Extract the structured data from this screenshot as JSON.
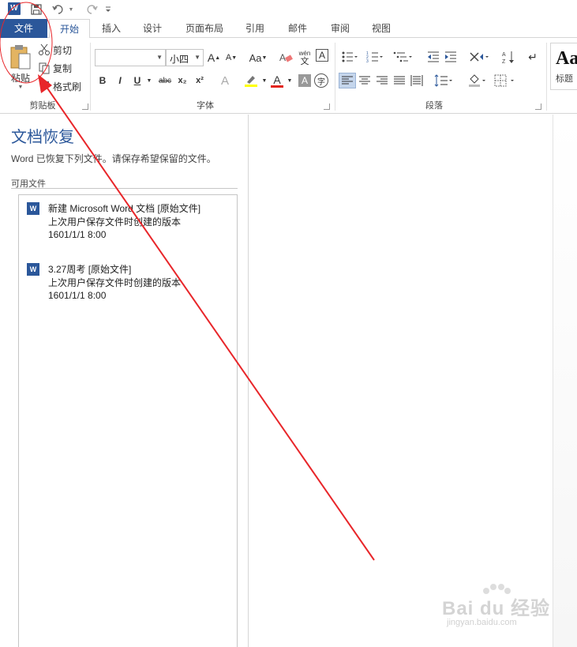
{
  "qat": {
    "app_logo": "W",
    "save_icon": "save-icon",
    "undo_icon": "undo-icon",
    "redo_icon": "redo-icon",
    "customize_icon": "chevron-down-icon"
  },
  "tabs": {
    "file": "文件",
    "home": "开始",
    "insert": "插入",
    "design": "设计",
    "layout": "页面布局",
    "references": "引用",
    "mailings": "邮件",
    "review": "审阅",
    "view": "视图"
  },
  "clipboard": {
    "paste": "粘贴",
    "cut": "剪切",
    "copy": "复制",
    "format_painter": "格式刷",
    "label": "剪贴板"
  },
  "font": {
    "name_value": "",
    "size_value": "小四",
    "grow": "A",
    "shrink": "A",
    "case": "Aa",
    "phonetic_top": "wén",
    "phonetic_bottom": "文",
    "border_char": "A",
    "bold": "B",
    "italic": "I",
    "underline": "U",
    "strike": "abc",
    "subscript": "x₂",
    "superscript": "x²",
    "effects": "A",
    "font_color": "A",
    "shading": "A",
    "enclose": "字",
    "label": "字体"
  },
  "paragraph": {
    "label": "段落"
  },
  "styles": {
    "sample": "Aa",
    "heading_label": "标题"
  },
  "recovery": {
    "title": "文档恢复",
    "description": "Word 已恢复下列文件。请保存希望保留的文件。",
    "available_label": "可用文件",
    "files": [
      {
        "name": "新建 Microsoft Word 文档  [原始文件]",
        "desc": "上次用户保存文件时创建的版本",
        "date": "1601/1/1 8:00"
      },
      {
        "name": "3.27周考  [原始文件]",
        "desc": "上次用户保存文件时创建的版本",
        "date": "1601/1/1 8:00"
      }
    ]
  },
  "watermark": {
    "main": "Bai du 经验",
    "sub": "jingyan.baidu.com"
  },
  "colors": {
    "accent": "#2b579a",
    "annotation": "#e8262a",
    "highlight": "#ffff00",
    "font_red": "#e2231a"
  }
}
